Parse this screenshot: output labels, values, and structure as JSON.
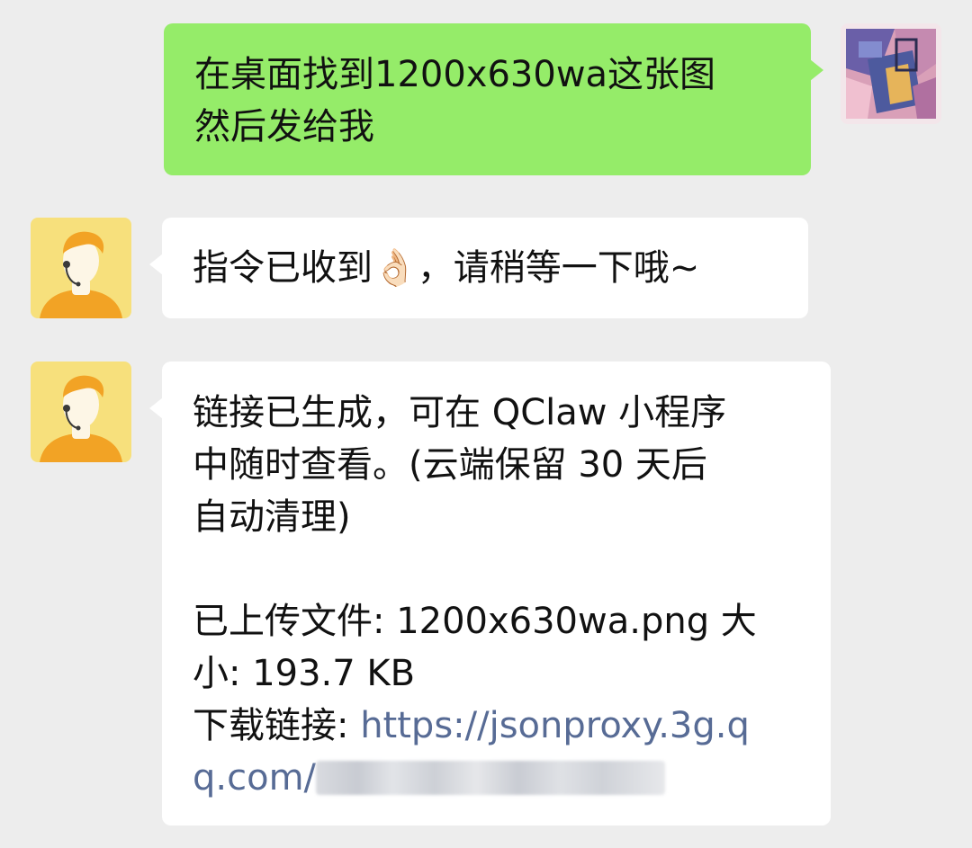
{
  "messages": [
    {
      "side": "sent",
      "lines": [
        "在桌面找到1200x630wa这张图",
        "然后发给我"
      ]
    },
    {
      "side": "received",
      "text_before": "指令已收到",
      "emoji": "👌🏻",
      "text_after": "，请稍等一下哦~"
    },
    {
      "side": "received",
      "lines": [
        "链接已生成，可在 QClaw 小程序",
        "中随时查看。(云端保留 30 天后",
        "自动清理)",
        "",
        "已上传文件: 1200x630wa.png 大",
        "小: 193.7 KB"
      ],
      "download_label": "下载链接: ",
      "link_line1": "https://jsonproxy.3g.q",
      "link_line2": "q.com/"
    }
  ],
  "colors": {
    "background": "#ededed",
    "sent_bubble": "#95ec69",
    "received_bubble": "#ffffff",
    "link": "#576b95"
  },
  "icons": {
    "self_avatar": "abstract-photo-avatar",
    "bot_avatar": "support-agent-avatar"
  }
}
